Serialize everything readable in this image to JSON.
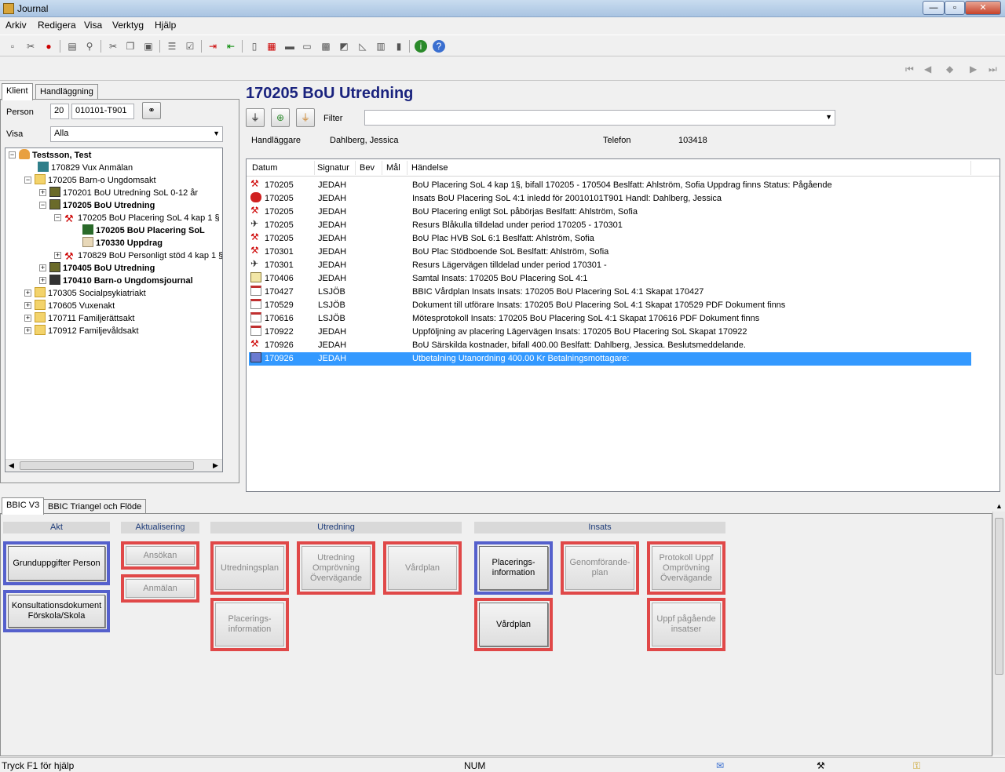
{
  "window": {
    "title": "Journal",
    "min": "—",
    "max": "▫",
    "close": "✕"
  },
  "menu": [
    "Arkiv",
    "Redigera",
    "Visa",
    "Verktyg",
    "Hjälp"
  ],
  "left": {
    "tabs": [
      "Klient",
      "Handläggning"
    ],
    "person_label": "Person",
    "person_prefix": "20",
    "person_id": "010101-T901",
    "visa_label": "Visa",
    "visa_value": "Alla",
    "tree": [
      {
        "label": "Testsson, Test",
        "bold": true
      },
      {
        "label": "170829 Vux Anmälan",
        "bold": false
      },
      {
        "label": "170205 Barn-o Ungdomsakt",
        "bold": false
      },
      {
        "label": "170201 BoU Utredning SoL 0-12 år",
        "bold": false
      },
      {
        "label": "170205 BoU Utredning",
        "bold": true
      },
      {
        "label": "170205 BoU Placering SoL 4 kap 1 §",
        "bold": false
      },
      {
        "label": "170205 BoU Placering SoL",
        "bold": true
      },
      {
        "label": "170330 Uppdrag",
        "bold": true
      },
      {
        "label": "170829 BoU Personligt stöd 4 kap 1 §",
        "bold": false
      },
      {
        "label": "170405 BoU Utredning",
        "bold": true
      },
      {
        "label": "170410 Barn-o Ungdomsjournal",
        "bold": true
      },
      {
        "label": "170305 Socialpsykiatriakt",
        "bold": false
      },
      {
        "label": "170605 Vuxenakt",
        "bold": false
      },
      {
        "label": "170711 Familjerättsakt",
        "bold": false
      },
      {
        "label": "170912 Familjevåldsakt",
        "bold": false
      }
    ]
  },
  "right": {
    "title": "170205 BoU Utredning",
    "filter_label": "Filter",
    "filter_value": "",
    "handlaggare_label": "Handläggare",
    "handlaggare_value": "Dahlberg, Jessica",
    "telefon_label": "Telefon",
    "telefon_value": "103418",
    "columns": [
      "Datum",
      "Signatur",
      "Bev",
      "Mål",
      "Händelse"
    ],
    "rows": [
      {
        "icon": "gavel-icon",
        "datum": "170205",
        "sign": "JEDAH",
        "text": "BoU Placering SoL 4 kap 1§, bifall 170205 - 170504   Beslfatt: Ahlström, Sofia Uppdrag finns  Status: Pågående"
      },
      {
        "icon": "insats-icon",
        "datum": "170205",
        "sign": "JEDAH",
        "text": "Insats BoU Placering SoL 4:1 inledd för 20010101T901  Handl: Dahlberg, Jessica"
      },
      {
        "icon": "gavel-icon",
        "datum": "170205",
        "sign": "JEDAH",
        "text": "BoU Placering enligt SoL påbörjas  Beslfatt: Ahlström, Sofia"
      },
      {
        "icon": "resource-icon",
        "datum": "170205",
        "sign": "JEDAH",
        "text": "Resurs Blåkulla tilldelad under period 170205 - 170301"
      },
      {
        "icon": "gavel-icon",
        "datum": "170205",
        "sign": "JEDAH",
        "text": "BoU Plac HVB SoL 6:1  Beslfatt: Ahlström, Sofia"
      },
      {
        "icon": "gavel-icon",
        "datum": "170301",
        "sign": "JEDAH",
        "text": "BoU Plac Stödboende SoL  Beslfatt: Ahlström, Sofia"
      },
      {
        "icon": "resource-icon",
        "datum": "170301",
        "sign": "JEDAH",
        "text": "Resurs Lägervägen tilldelad under period 170301 -"
      },
      {
        "icon": "note-icon",
        "datum": "170406",
        "sign": "JEDAH",
        "text": "Samtal Insats: 170205 BoU Placering SoL 4:1"
      },
      {
        "icon": "document-icon",
        "datum": "170427",
        "sign": "LSJÖB",
        "text": "BBIC Vårdplan Insats Insats: 170205 BoU Placering SoL 4:1 Skapat 170427"
      },
      {
        "icon": "document-icon",
        "datum": "170529",
        "sign": "LSJÖB",
        "text": "Dokument till utförare Insats: 170205 BoU Placering SoL 4:1 Skapat 170529 PDF Dokument finns"
      },
      {
        "icon": "document-icon",
        "datum": "170616",
        "sign": "LSJÖB",
        "text": "Mötesprotokoll Insats: 170205 BoU Placering SoL 4:1 Skapat 170616 PDF Dokument finns"
      },
      {
        "icon": "document-icon",
        "datum": "170922",
        "sign": "JEDAH",
        "text": "Uppföljning av placering Lägervägen Insats: 170205 BoU Placering SoL Skapat 170922"
      },
      {
        "icon": "gavel-icon",
        "datum": "170926",
        "sign": "JEDAH",
        "text": "BoU Särskilda kostnader, bifall 400.00  Beslfatt: Dahlberg, Jessica.     Beslutsmeddelande."
      },
      {
        "icon": "payment-icon",
        "datum": "170926",
        "sign": "JEDAH",
        "text": "Utbetalning Utanordning 400.00 Kr Betalningsmottagare:",
        "selected": true
      }
    ]
  },
  "bottom": {
    "tabs": [
      "BBIC V3",
      "BBIC Triangel och Flöde"
    ],
    "sections": {
      "akt": "Akt",
      "aktualisering": "Aktualisering",
      "utredning": "Utredning",
      "insats": "Insats"
    },
    "buttons": {
      "grunduppgifter": "Grunduppgifter Person",
      "konsultation": "Konsultationsdokument Förskola/Skola",
      "ansokan": "Ansökan",
      "anmalan": "Anmälan",
      "utredningsplan": "Utredningsplan",
      "utredning_omprovning": "Utredning Omprövning Övervägande",
      "vardplan_utr": "Vårdplan",
      "placeringsinfo_utr": "Placerings-information",
      "placeringsinfo_ins": "Placerings-information",
      "genomforandeplan": "Genomförande-plan",
      "protokoll": "Protokoll Uppf Omprövning Övervägande",
      "vardplan_ins": "Vårdplan",
      "uppf_pagaende": "Uppf pågående insatser"
    }
  },
  "status": {
    "help": "Tryck F1 för hjälp",
    "num": "NUM"
  },
  "colors": {
    "selected_row": "#3399ff",
    "title": "#1a237e",
    "frame_red": "#e04848",
    "frame_blue": "#5560cc"
  }
}
